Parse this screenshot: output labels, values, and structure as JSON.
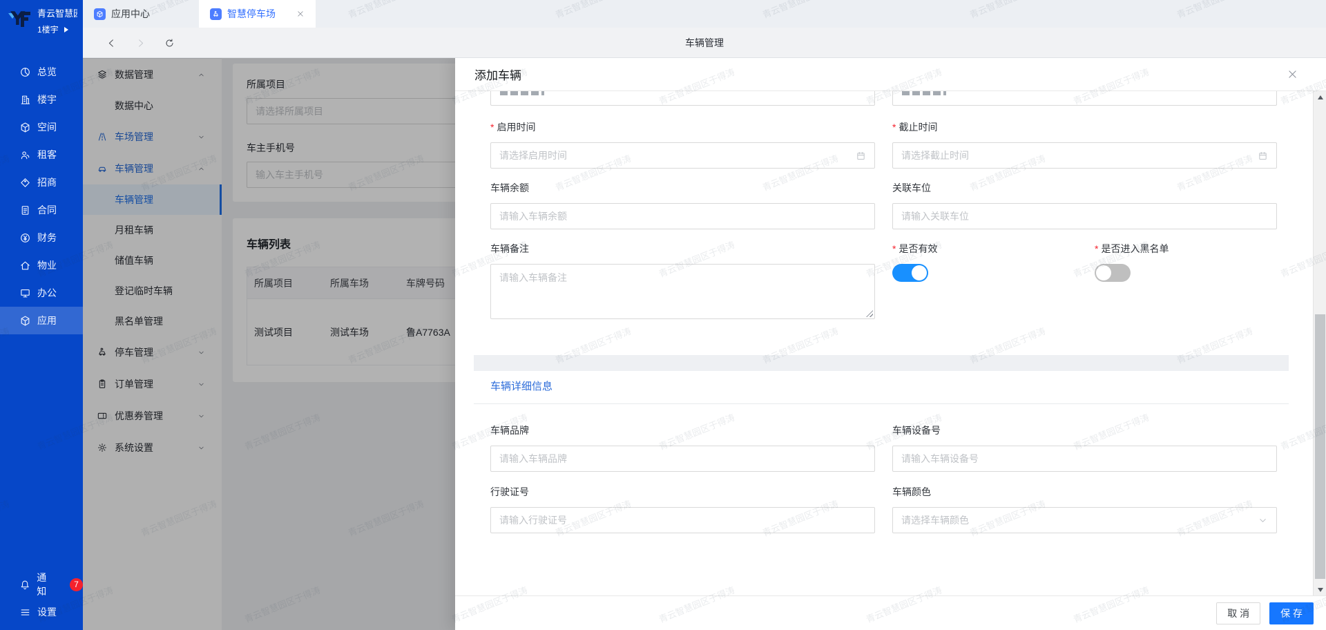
{
  "watermark": {
    "text": "青云智慧园区于得涛"
  },
  "colors": {
    "rail": "#0647c8",
    "accent": "#1677ff",
    "switch_on": "#1890ff",
    "selected_menu": "#1d6fe8",
    "section_title": "#2b6bd9",
    "badge": "#f5222d"
  },
  "logo": {
    "title": "青云智慧园",
    "subtitle": "1楼宇"
  },
  "tabs": [
    {
      "label": "应用中心"
    },
    {
      "label": "智慧停车场"
    }
  ],
  "navbar": {
    "title": "车辆管理"
  },
  "sidebar": {
    "items": [
      {
        "label": "总览"
      },
      {
        "label": "楼宇"
      },
      {
        "label": "空间"
      },
      {
        "label": "租客"
      },
      {
        "label": "招商"
      },
      {
        "label": "合同"
      },
      {
        "label": "财务"
      },
      {
        "label": "物业"
      },
      {
        "label": "办公"
      },
      {
        "label": "应用"
      }
    ],
    "bottom": [
      {
        "label": "通知",
        "badge": "7"
      },
      {
        "label": "设置"
      }
    ]
  },
  "submenu": {
    "items": [
      {
        "label": "数据管理"
      },
      {
        "label": "数据中心"
      },
      {
        "label": "车场管理"
      },
      {
        "label": "车辆管理"
      },
      {
        "label": "车辆管理"
      },
      {
        "label": "月租车辆"
      },
      {
        "label": "储值车辆"
      },
      {
        "label": "登记临时车辆"
      },
      {
        "label": "黑名单管理"
      },
      {
        "label": "停车管理"
      },
      {
        "label": "订单管理"
      },
      {
        "label": "优惠券管理"
      },
      {
        "label": "系统设置"
      }
    ]
  },
  "content": {
    "filter": {
      "project_label": "所属项目",
      "project_placeholder": "请选择所属项目",
      "phone_label": "车主手机号",
      "phone_placeholder": "输入车主手机号"
    },
    "list": {
      "title": "车辆列表",
      "columns": [
        "所属项目",
        "所属车场",
        "车牌号码"
      ],
      "rows": [
        [
          "测试项目",
          "测试车场",
          "鲁A7763A"
        ]
      ]
    }
  },
  "drawer": {
    "title": "添加车辆",
    "fields": {
      "start_time": {
        "label": "启用时间",
        "placeholder": "请选择启用时间"
      },
      "end_time": {
        "label": "截止时间",
        "placeholder": "请选择截止时间"
      },
      "balance": {
        "label": "车辆余额",
        "placeholder": "请输入车辆余额"
      },
      "space": {
        "label": "关联车位",
        "placeholder": "请输入关联车位"
      },
      "remark": {
        "label": "车辆备注",
        "placeholder": "请输入车辆备注"
      },
      "valid": {
        "label": "是否有效",
        "state": "on"
      },
      "blacklist": {
        "label": "是否进入黑名单",
        "state": "off"
      },
      "section2_title": "车辆详细信息",
      "brand": {
        "label": "车辆品牌",
        "placeholder": "请输入车辆品牌"
      },
      "device": {
        "label": "车辆设备号",
        "placeholder": "请输入车辆设备号"
      },
      "license": {
        "label": "行驶证号",
        "placeholder": "请输入行驶证号"
      },
      "color": {
        "label": "车辆颜色",
        "placeholder": "请选择车辆颜色"
      }
    },
    "footer": {
      "cancel": "取 消",
      "save": "保 存"
    }
  }
}
